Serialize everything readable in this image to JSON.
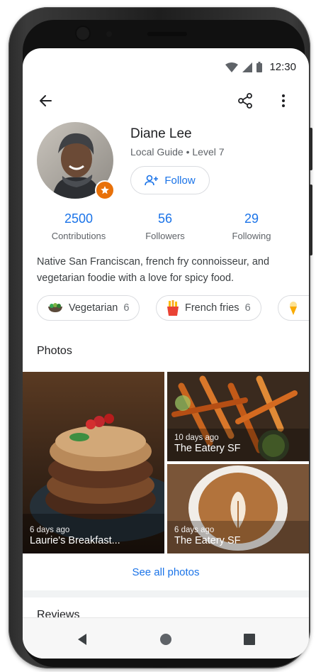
{
  "status_bar": {
    "time": "12:30",
    "icons": [
      "wifi-icon",
      "signal-icon",
      "battery-icon"
    ]
  },
  "appbar": {
    "back_icon": "back-arrow-icon",
    "share_icon": "share-icon",
    "more_icon": "more-vert-icon"
  },
  "profile": {
    "name": "Diane Lee",
    "level": "Local Guide • Level 7",
    "badge_icon": "star-icon",
    "follow_label": "Follow",
    "follow_icon": "person-add-icon"
  },
  "stats": [
    {
      "value": "2500",
      "label": "Contributions"
    },
    {
      "value": "56",
      "label": "Followers"
    },
    {
      "value": "29",
      "label": "Following"
    }
  ],
  "bio": "Native San Franciscan, french fry connoisseur, and vegetarian foodie with a love for spicy food.",
  "chips": [
    {
      "label": "Vegetarian",
      "count": "6",
      "icon": "salad-bowl-icon"
    },
    {
      "label": "French fries",
      "count": "6",
      "icon": "french-fries-icon"
    },
    {
      "label": "",
      "count": "",
      "icon": "ice-cream-icon"
    }
  ],
  "photos_section": {
    "title": "Photos",
    "items": [
      {
        "time": "6 days ago",
        "place": "Laurie's Breakfast..."
      },
      {
        "time": "10 days ago",
        "place": "The Eatery SF"
      },
      {
        "time": "6 days ago",
        "place": "The Eatery SF"
      }
    ],
    "see_all_label": "See all photos"
  },
  "reviews_section": {
    "title": "Reviews"
  },
  "nav_bar": {
    "back_icon": "nav-back-icon",
    "home_icon": "nav-home-icon",
    "recents_icon": "nav-recents-icon"
  },
  "colors": {
    "accent": "#1a73e8",
    "badge": "#e8710a",
    "text_primary": "#202124",
    "text_secondary": "#5f6368"
  }
}
